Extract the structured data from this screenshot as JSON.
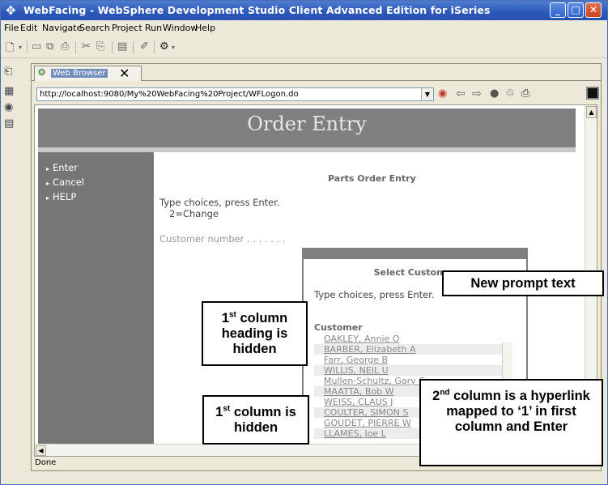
{
  "window": {
    "title": "WebFacing - WebSphere Development Studio Client Advanced Edition for iSeries",
    "controls": [
      "_",
      "□",
      "✕"
    ]
  },
  "menu": [
    "File",
    "Edit",
    "Navigate",
    "Search",
    "Project",
    "Run",
    "Window",
    "Help"
  ],
  "browser": {
    "tab_label": "Web Browser",
    "tab_close": "✕",
    "url": "http://localhost:9080/My%20WebFacing%20Project/WFLogon.do",
    "status": "Done"
  },
  "page": {
    "header": "Order Entry",
    "nav_items": [
      "Enter",
      "Cancel",
      "HELP"
    ],
    "form_title": "Parts Order Entry",
    "instruction_1": "Type choices, press Enter.",
    "instruction_2": "2=Change",
    "customer_label": "Customer number . . . . . . ."
  },
  "dialog": {
    "title": "Select Customer",
    "instruction": "Type choices, press Enter.",
    "column_heading": "Customer",
    "customers": [
      "OAKLEY, Annie O",
      "BARBER, Elizabeth A",
      "Farr, George B",
      "WILLIS, NEIL U",
      "Mullen-Schultz, Gary C",
      "MAATTA, Bob W",
      "WEISS, CLAUS J",
      "COULTER, SIMON S",
      "GOUDET, PIERRE W",
      "LLAMES, Joe L"
    ]
  },
  "callouts": {
    "new_prompt": "New prompt text",
    "first_col_heading": {
      "ordinal": "1",
      "sup": "st",
      "text": " column heading is hidden"
    },
    "first_col": {
      "ordinal": "1",
      "sup": "st",
      "text": " column is hidden"
    },
    "second_col": {
      "ordinal": "2",
      "sup": "nd",
      "text": " column is a hyperlink mapped to ‘1’ in first column and Enter"
    }
  }
}
